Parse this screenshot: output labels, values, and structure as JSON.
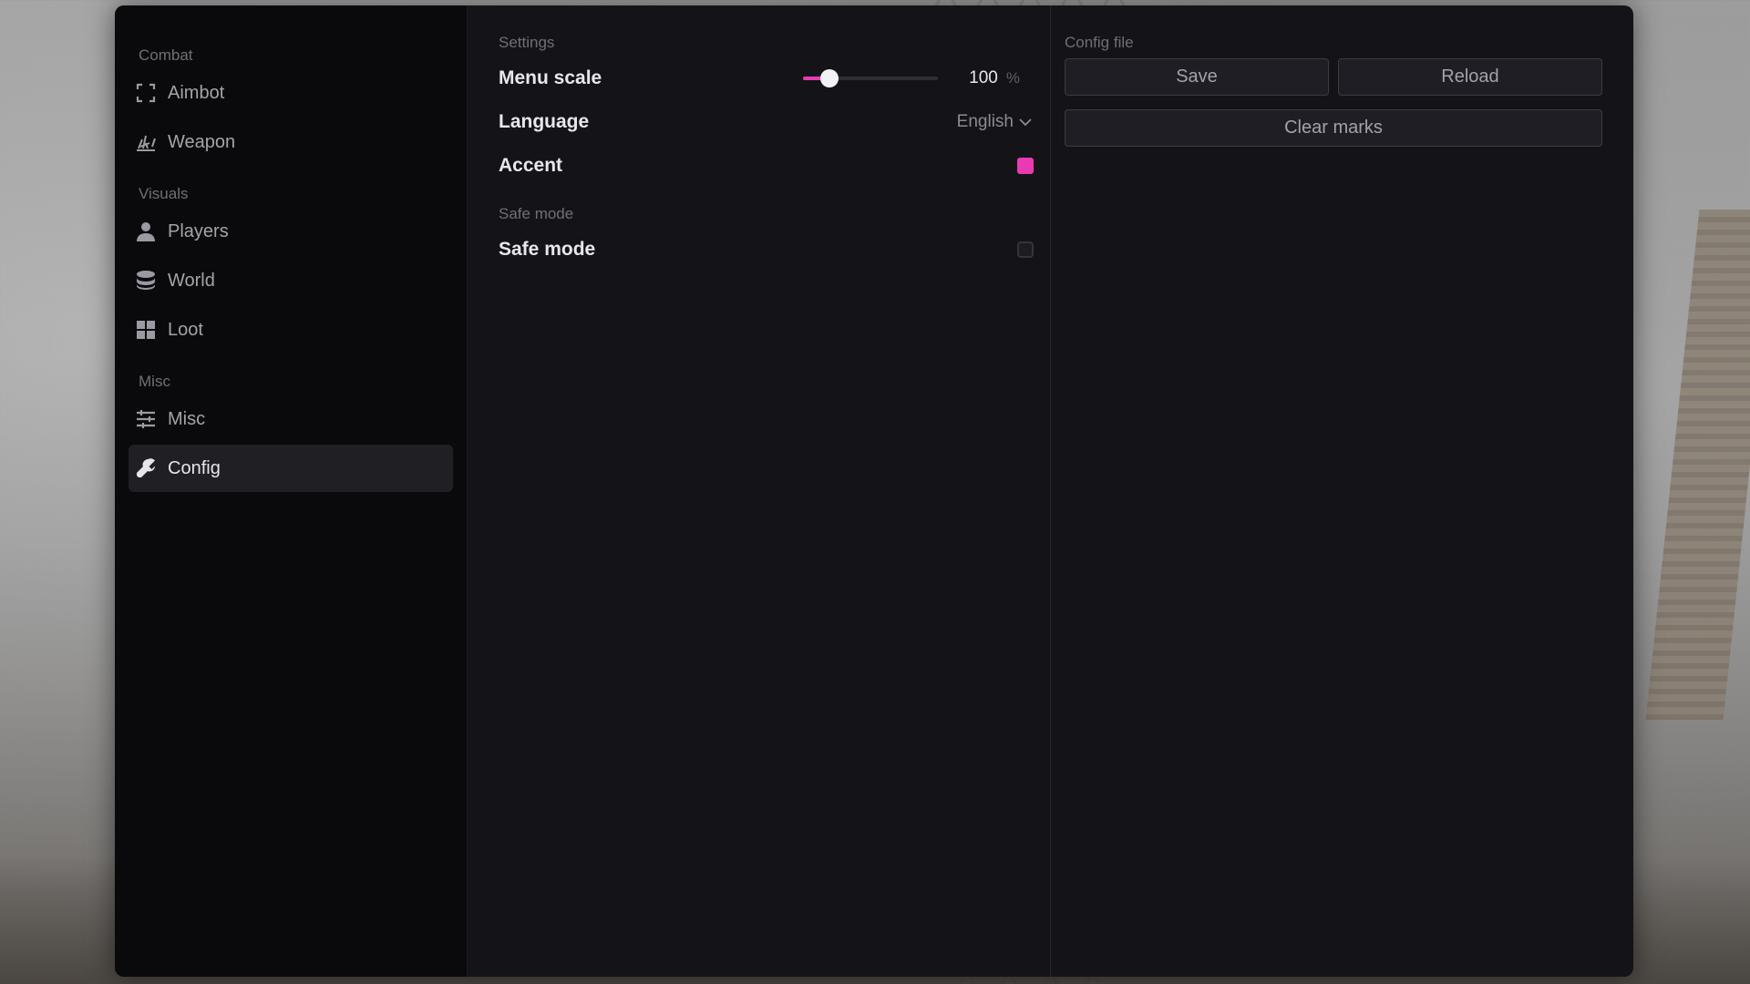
{
  "sidebar": {
    "groups": [
      {
        "label": "Combat",
        "items": [
          {
            "label": "Aimbot",
            "icon": "crosshair-frame-icon"
          },
          {
            "label": "Weapon",
            "icon": "weapon-icon"
          }
        ]
      },
      {
        "label": "Visuals",
        "items": [
          {
            "label": "Players",
            "icon": "person-icon"
          },
          {
            "label": "World",
            "icon": "world-layers-icon"
          },
          {
            "label": "Loot",
            "icon": "grid-icon"
          }
        ]
      },
      {
        "label": "Misc",
        "items": [
          {
            "label": "Misc",
            "icon": "sliders-icon"
          },
          {
            "label": "Config",
            "icon": "wrench-icon",
            "active": true
          }
        ]
      }
    ]
  },
  "settings": {
    "section_label": "Settings",
    "menu_scale": {
      "label": "Menu scale",
      "value": "100",
      "unit": "%",
      "fraction": 0.2
    },
    "language": {
      "label": "Language",
      "value": "English"
    },
    "accent": {
      "label": "Accent",
      "color": "#e83bb3"
    },
    "safe_mode_section": "Safe mode",
    "safe_mode": {
      "label": "Safe mode",
      "checked": false
    }
  },
  "config": {
    "section_label": "Config file",
    "save_label": "Save",
    "reload_label": "Reload",
    "clear_label": "Clear marks"
  }
}
